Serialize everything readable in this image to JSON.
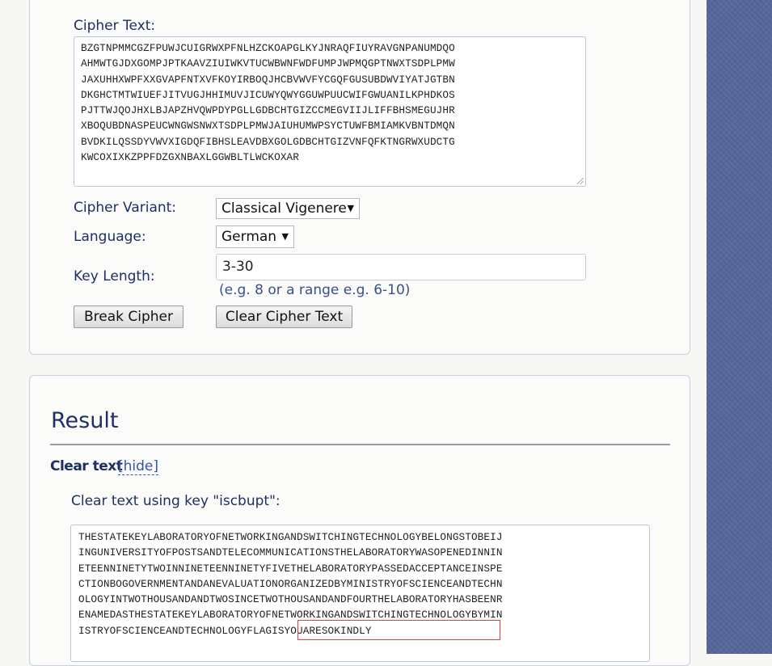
{
  "cipher_form": {
    "cipher_text_label": "Cipher Text:",
    "cipher_text_lines": [
      "BZGTNPMMCGZFPUWJCUIGRWXPFNLHZCKOAPGLKYJNRAQFIUYRAVGNPANUMDQO",
      "AHMWTGJDXGOMPJPTKAAVZIUIWKVTUCWBWNFWDFUMPJWPMQGPTNWXTSDPLPMW",
      "JAXUHHXWPFXXGVAPFNTXVFKOYIRBOQJHCBVWVFYCGQFGUSUBDWVIYATJGTBN",
      "DKGHCTMTWIUEFJITVUGJHHIMUVJICUWYQWYGGUWPUUCWIFGWUANILKPHDKOS",
      "PJTTWJQOJHXLBJAPZHVQWPDYPGLLGDBCHTGIZCCMEGVIIJLIFFBHSMEGUJHR",
      "XBOQUBDNASPEUCWNGWSNWXTSDPLPMWJAIUHUMWPSYCTUWFBMIAMKVBNTDMQN",
      "BVDKILQSSDYVWVXIGDQFIBHSLEAVDBXGOLGDBCHTGIZVNFQFKTNGRWXUDCTG",
      "KWCOXIXKZPPFDZGXNBAXLGGWBLTLWCKOXAR"
    ],
    "cipher_variant_label": "Cipher Variant:",
    "cipher_variant_value": "Classical Vigenere",
    "language_label": "Language:",
    "language_value": "German",
    "key_length_label": "Key Length:",
    "key_length_value": "3-30",
    "key_length_hint": "(e.g. 8 or a range e.g. 6-10)",
    "break_button": "Break Cipher",
    "clear_button": "Clear Cipher Text"
  },
  "result": {
    "title": "Result",
    "clear_text_heading": "Clear text",
    "hide_link": "[hide]",
    "key_label": "Clear text using key \"iscbupt\":",
    "clear_text_lines": [
      "THESTATEKEYLABORATORYOFNETWORKINGANDSWITCHINGTECHNOLOGYBELONGSTOBEIJ",
      "INGUNIVERSITYOFPOSTSANDTELECOMMUNICATIONSTHELABORATORYWASOPENEDINNIN",
      "ETEENNINETYTWOINNINETEENNINETYFIVETHELABORATORYPASSEDACCEPTANCEINSPE",
      "CTIONBOGOVERNMENTANDANEVALUATIONORGANIZEDBYMINISTRYOFSCIENCEANDTECHN",
      "OLOGYINTWOTHOUSANDANDTWOSINCETWOTHOUSANDANDFOURTHELABORATORYHASBEENR",
      "ENAMEDASTHESTATEKEYLABORATORYOFNETWORKINGANDSWITCHINGTECHNOLOGYBYMIN",
      "ISTRYOFSCIENCEANDTECHNOLOGYFLAGISYOUARESOKINDLY"
    ]
  },
  "icons": {
    "dropdown": "chevron-down-icon",
    "resize": "resize-handle-icon"
  },
  "colors": {
    "panel_border": "#c7d0e4",
    "text_primary": "#1d2f63",
    "link": "#2f56a8",
    "highlight": "#e04040",
    "sidebar": "#55679a"
  }
}
